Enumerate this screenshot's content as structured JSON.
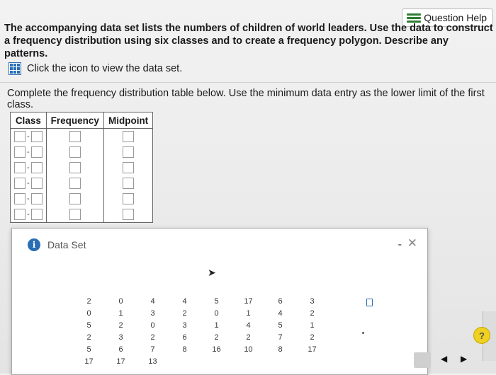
{
  "header": {
    "help_label": "Question Help",
    "help_icon": "list-icon"
  },
  "intro_text": "The accompanying data set lists the numbers of children of world leaders. Use the data to construct a frequency distribution using six classes and to create a frequency polygon. Describe any patterns.",
  "data_link": {
    "label": "Click the icon to view the data set.",
    "icon": "grid-icon"
  },
  "instruction": "Complete the frequency distribution table below. Use the minimum data entry as the lower limit of the first class.",
  "freq_table": {
    "headers": [
      "Class",
      "Frequency",
      "Midpoint"
    ],
    "rows": 6,
    "class_separator": "-"
  },
  "dialog": {
    "title": "Data Set",
    "info_icon": "i",
    "minimize": "-",
    "close": "✕",
    "columns": [
      [
        "2",
        "0",
        "5",
        "2",
        "5",
        "17"
      ],
      [
        "0",
        "1",
        "2",
        "3",
        "6",
        "17"
      ],
      [
        "4",
        "3",
        "0",
        "2",
        "7",
        "13"
      ],
      [
        "4",
        "2",
        "3",
        "6",
        "8",
        ""
      ],
      [
        "5",
        "0",
        "1",
        "2",
        "16",
        ""
      ],
      [
        "17",
        "1",
        "4",
        "2",
        "10",
        ""
      ],
      [
        "6",
        "4",
        "5",
        "7",
        "8",
        ""
      ],
      [
        "3",
        "2",
        "1",
        "2",
        "17",
        ""
      ]
    ]
  },
  "footer": {
    "help": "?",
    "prev": "◀",
    "next": "▶"
  }
}
